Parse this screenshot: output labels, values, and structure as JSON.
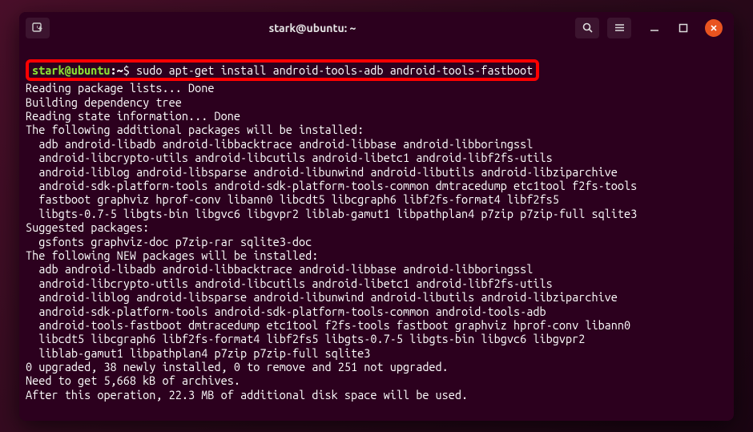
{
  "titlebar": {
    "title": "stark@ubuntu: ~"
  },
  "prompt": {
    "user_host": "stark@ubuntu",
    "path": ":~",
    "symbol": "$",
    "command": "sudo apt-get install android-tools-adb android-tools-fastboot"
  },
  "output": [
    "Reading package lists... Done",
    "Building dependency tree",
    "Reading state information... Done",
    "The following additional packages will be installed:",
    "  adb android-libadb android-libbacktrace android-libbase android-libboringssl",
    "  android-libcrypto-utils android-libcutils android-libetc1 android-libf2fs-utils",
    "  android-liblog android-libsparse android-libunwind android-libutils android-libziparchive",
    "  android-sdk-platform-tools android-sdk-platform-tools-common dmtracedump etc1tool f2fs-tools",
    "  fastboot graphviz hprof-conv libann0 libcdt5 libcgraph6 libf2fs-format4 libf2fs5",
    "  libgts-0.7-5 libgts-bin libgvc6 libgvpr2 liblab-gamut1 libpathplan4 p7zip p7zip-full sqlite3",
    "Suggested packages:",
    "  gsfonts graphviz-doc p7zip-rar sqlite3-doc",
    "The following NEW packages will be installed:",
    "  adb android-libadb android-libbacktrace android-libbase android-libboringssl",
    "  android-libcrypto-utils android-libcutils android-libetc1 android-libf2fs-utils",
    "  android-liblog android-libsparse android-libunwind android-libutils android-libziparchive",
    "  android-sdk-platform-tools android-sdk-platform-tools-common android-tools-adb",
    "  android-tools-fastboot dmtracedump etc1tool f2fs-tools fastboot graphviz hprof-conv libann0",
    "  libcdt5 libcgraph6 libf2fs-format4 libf2fs5 libgts-0.7-5 libgts-bin libgvc6 libgvpr2",
    "  liblab-gamut1 libpathplan4 p7zip p7zip-full sqlite3",
    "0 upgraded, 38 newly installed, 0 to remove and 251 not upgraded.",
    "Need to get 5,668 kB of archives.",
    "After this operation, 22.3 MB of additional disk space will be used."
  ]
}
